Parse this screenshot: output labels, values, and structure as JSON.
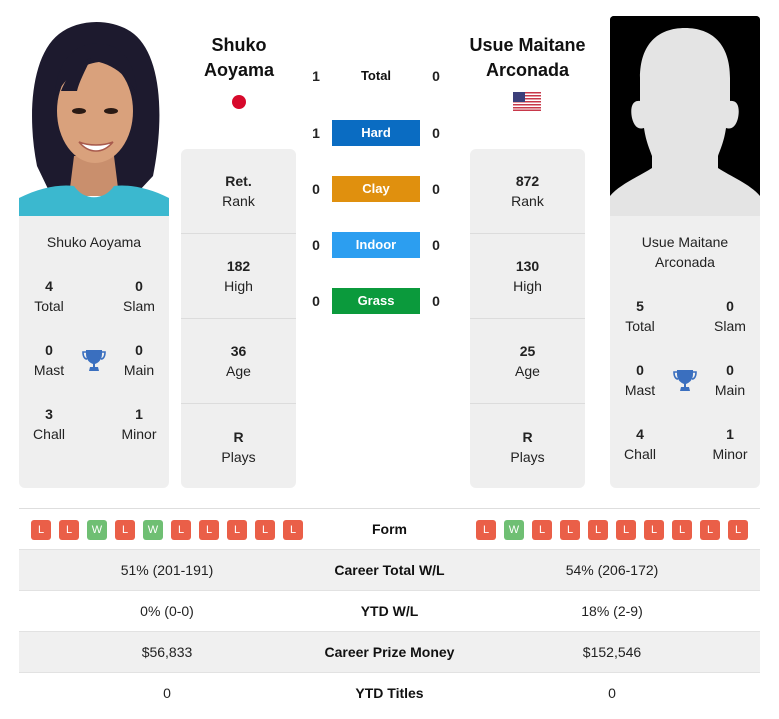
{
  "colors": {
    "hard": "#0a6cc2",
    "clay": "#e0900e",
    "indoor": "#2c9ef0",
    "grass": "#0b9a3c",
    "loss": "#ea5f48",
    "win": "#6fbf73",
    "trophy": "#3a6fbf",
    "card_bg": "#efefef"
  },
  "player_left": {
    "name": "Shuko Aoyama",
    "name_line1": "Shuko",
    "name_line2": "Aoyama",
    "flag": "japan-flag",
    "photo": "player-photo",
    "titles": {
      "total": {
        "value": "4",
        "label": "Total"
      },
      "slam": {
        "value": "0",
        "label": "Slam"
      },
      "mast": {
        "value": "0",
        "label": "Mast"
      },
      "main": {
        "value": "0",
        "label": "Main"
      },
      "chall": {
        "value": "3",
        "label": "Chall"
      },
      "minor": {
        "value": "1",
        "label": "Minor"
      }
    },
    "rank": {
      "value": "Ret.",
      "label": "Rank"
    },
    "high": {
      "value": "182",
      "label": "High"
    },
    "age": {
      "value": "36",
      "label": "Age"
    },
    "plays": {
      "value": "R",
      "label": "Plays"
    },
    "form": [
      "L",
      "L",
      "W",
      "L",
      "W",
      "L",
      "L",
      "L",
      "L",
      "L"
    ]
  },
  "player_right": {
    "name": "Usue Maitane Arconada",
    "name_line1": "Usue Maitane",
    "name_line2": "Arconada",
    "side_name_line1": "Usue Maitane",
    "side_name_line2": "Arconada",
    "flag": "usa-flag",
    "photo": "silhouette-placeholder",
    "titles": {
      "total": {
        "value": "5",
        "label": "Total"
      },
      "slam": {
        "value": "0",
        "label": "Slam"
      },
      "mast": {
        "value": "0",
        "label": "Mast"
      },
      "main": {
        "value": "0",
        "label": "Main"
      },
      "chall": {
        "value": "4",
        "label": "Chall"
      },
      "minor": {
        "value": "1",
        "label": "Minor"
      }
    },
    "rank": {
      "value": "872",
      "label": "Rank"
    },
    "high": {
      "value": "130",
      "label": "High"
    },
    "age": {
      "value": "25",
      "label": "Age"
    },
    "plays": {
      "value": "R",
      "label": "Plays"
    },
    "form": [
      "L",
      "W",
      "L",
      "L",
      "L",
      "L",
      "L",
      "L",
      "L",
      "L"
    ]
  },
  "h2h": [
    {
      "surface": "Total",
      "left": "1",
      "right": "0",
      "color": ""
    },
    {
      "surface": "Hard",
      "left": "1",
      "right": "0",
      "color": "#0a6cc2"
    },
    {
      "surface": "Clay",
      "left": "0",
      "right": "0",
      "color": "#e0900e"
    },
    {
      "surface": "Indoor",
      "left": "0",
      "right": "0",
      "color": "#2c9ef0"
    },
    {
      "surface": "Grass",
      "left": "0",
      "right": "0",
      "color": "#0b9a3c"
    }
  ],
  "comparison": {
    "form_label": "Form",
    "rows": [
      {
        "label": "Career Total W/L",
        "left": "51% (201-191)",
        "right": "54% (206-172)"
      },
      {
        "label": "YTD W/L",
        "left": "0% (0-0)",
        "right": "18% (2-9)"
      },
      {
        "label": "Career Prize Money",
        "left": "$56,833",
        "right": "$152,546"
      },
      {
        "label": "YTD Titles",
        "left": "0",
        "right": "0"
      }
    ]
  }
}
